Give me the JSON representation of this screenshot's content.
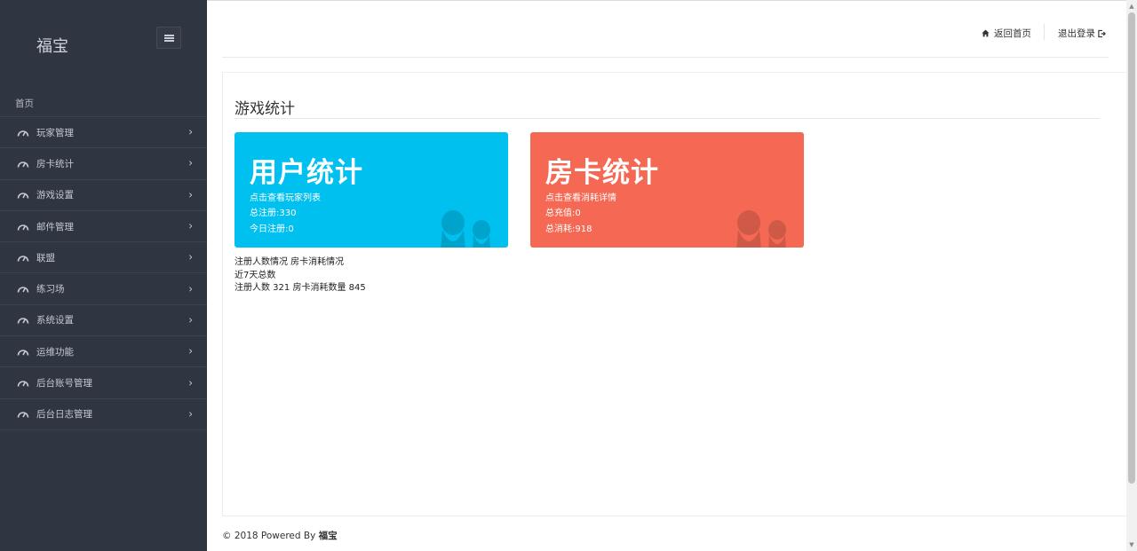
{
  "sidebar": {
    "brand": "福宝",
    "home_label": "首页",
    "items": [
      {
        "label": "玩家管理"
      },
      {
        "label": "房卡统计"
      },
      {
        "label": "游戏设置"
      },
      {
        "label": "邮件管理"
      },
      {
        "label": "联盟"
      },
      {
        "label": "练习场"
      },
      {
        "label": "系统设置"
      },
      {
        "label": "运维功能"
      },
      {
        "label": "后台账号管理"
      },
      {
        "label": "后台日志管理"
      }
    ]
  },
  "topbar": {
    "home_link": "返回首页",
    "logout_link": "退出登录"
  },
  "main": {
    "title": "游戏统计",
    "cards": [
      {
        "title": "用户统计",
        "link": "点击查看玩家列表",
        "line1": "总注册:330",
        "line2": "今日注册:0",
        "color": "#00c0ef"
      },
      {
        "title": "房卡统计",
        "link": "点击查看消耗详情",
        "line1": "总充值:0",
        "line2": "总消耗:918",
        "color": "#f56954"
      }
    ],
    "stats": {
      "header": "注册人数情况 房卡消耗情况",
      "period": "近7天总数",
      "values": "注册人数 321 房卡消耗数量 845"
    }
  },
  "footer": {
    "prefix": "© 2018 Powered By",
    "brand": "福宝"
  },
  "colors": {
    "sidebar_bg": "#2f3541",
    "user_card": "#00c0ef",
    "room_card": "#f56954"
  }
}
